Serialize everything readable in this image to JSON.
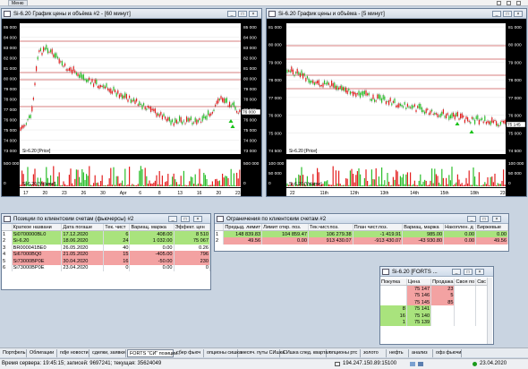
{
  "topbar": {
    "menu_label": "Меню"
  },
  "chart_left": {
    "title": "Si-6.20 График цены и объёма #2 - [60 минут]",
    "price_ticks": [
      "85 000",
      "84 000",
      "83 000",
      "82 000",
      "81 000",
      "80 000",
      "79 000",
      "78 000",
      "77 000",
      "76 000",
      "75 000",
      "74 000",
      "73 000"
    ],
    "price_label": "Si-6.20 [Price]",
    "volume_label": "Si-6.20 [Volume]",
    "volume_ticks": [
      "500 000",
      "0"
    ],
    "date_ticks": [
      "17",
      "20",
      "23",
      "26",
      "30",
      "Apr",
      "6",
      "8",
      "13",
      "16",
      "20",
      "23"
    ],
    "last_price": "76 000"
  },
  "chart_right": {
    "title": "Si-6.20 График цены и объёма - [5 минут]",
    "price_ticks": [
      "81 000",
      "80 000",
      "79 000",
      "78 000",
      "77 000",
      "76 000",
      "75 000",
      "74 500"
    ],
    "price_label": "Si-6.20 [Price]",
    "volume_label": "Si-6.20 [Volume]",
    "volume_ticks": [
      "100 000",
      "50 000",
      "0"
    ],
    "date_ticks": [
      "22",
      "11th",
      "12th",
      "13th",
      "14th",
      "15th",
      "18th",
      "23"
    ],
    "last_price": "75 145"
  },
  "positions": {
    "title": "Позиции по клиентским счетам (фьючерсы) #2",
    "headers": [
      "",
      "Краткое названи",
      "Дата погаше",
      "Тек. чист",
      "Вариац. маржа",
      "Эффект. цен"
    ],
    "rows": [
      {
        "n": "1",
        "name": "Si0700000BL0",
        "date": "17.12.2020",
        "qty": "6",
        "vm": "408.00",
        "price": "8 510",
        "style": "g"
      },
      {
        "n": "2",
        "name": "Si-6.20",
        "date": "18.06.2020",
        "qty": "24",
        "vm": "1 032.00",
        "price": "75 067",
        "style": "g"
      },
      {
        "n": "3",
        "name": "BR000041BE0",
        "date": "26.05.2020",
        "qty": "40",
        "vm": "0.00",
        "price": "0.26",
        "style": ""
      },
      {
        "n": "4",
        "name": "Si67000BQ0",
        "date": "21.05.2020",
        "qty": "15",
        "vm": "-405.00",
        "price": "796",
        "style": "r"
      },
      {
        "n": "5",
        "name": "Si73000BP0E",
        "date": "30.04.2020",
        "qty": "16",
        "vm": "-50.00",
        "price": "230",
        "style": "r"
      },
      {
        "n": "6",
        "name": "Si73000BP0E",
        "date": "23.04.2020",
        "qty": "0",
        "vm": "0.00",
        "price": "0",
        "style": ""
      }
    ]
  },
  "limits": {
    "title": "Ограничения по клиентским счетам #2",
    "headers": [
      "",
      "Предыд. лимит",
      "Лимит откр. поз.",
      "Тек.чист.поз.",
      "План чист.поз.",
      "Вариац. маржа",
      "Накоплен. д",
      "Биржевые"
    ],
    "rows": [
      {
        "n": "1",
        "prev": "148 839.83",
        "open": "104 859.47",
        "cur": "106 279.38",
        "plan": "-1 419.91",
        "vm": "985.00",
        "acc": "0.00",
        "ex": "0.00",
        "style": "g"
      },
      {
        "n": "2",
        "prev": "49.56",
        "open": "0.00",
        "cur": "913 430.07",
        "plan": "-913 430.07",
        "vm": "-43 930.80",
        "acc": "0.00",
        "ex": "49.56",
        "style": "r"
      }
    ]
  },
  "orderbook": {
    "title": "Si-6.20 [FORTS ...",
    "headers": [
      "Покупка",
      "Цена",
      "Продажа",
      "Своя по",
      "Свс"
    ],
    "rows": [
      {
        "buy": "",
        "price": "75 147",
        "sell": "23",
        "side": "s"
      },
      {
        "buy": "",
        "price": "75 146",
        "sell": "5",
        "side": "s"
      },
      {
        "buy": "",
        "price": "75 145",
        "sell": "85",
        "side": "s"
      },
      {
        "buy": "8",
        "price": "75 141",
        "sell": "",
        "side": "b"
      },
      {
        "buy": "16",
        "price": "75 140",
        "sell": "",
        "side": "b"
      },
      {
        "buy": "1",
        "price": "75 139",
        "sell": "",
        "side": "b"
      }
    ]
  },
  "tabs": [
    {
      "label": "Портфель"
    },
    {
      "label": "Облигации"
    },
    {
      "label": "ndje новости"
    },
    {
      "label": "сделки, заявки"
    },
    {
      "label": "FORTS \"СИ\" позиции..",
      "active": true
    },
    {
      "label": "сбер фьюч"
    },
    {
      "label": "опционы сишка"
    },
    {
      "label": "месяч. путы СИшка"
    },
    {
      "label": "СИшка след. квартал"
    },
    {
      "label": "опционы ртс"
    },
    {
      "label": "золото"
    },
    {
      "label": "нефть"
    },
    {
      "label": "анализ"
    },
    {
      "label": "офз фьючи"
    }
  ],
  "status": {
    "left": "Время сервера: 19:45:15; записей: 9697241; текущая: 35624049",
    "ip": "194.247.150.89:15100",
    "date": "23.04.2020"
  },
  "colors": {
    "up": "#2bbf2b",
    "down": "#e32020",
    "positive_row": "#a9e37d",
    "negative_row": "#f3a2a2",
    "level_line": "#b00000"
  }
}
